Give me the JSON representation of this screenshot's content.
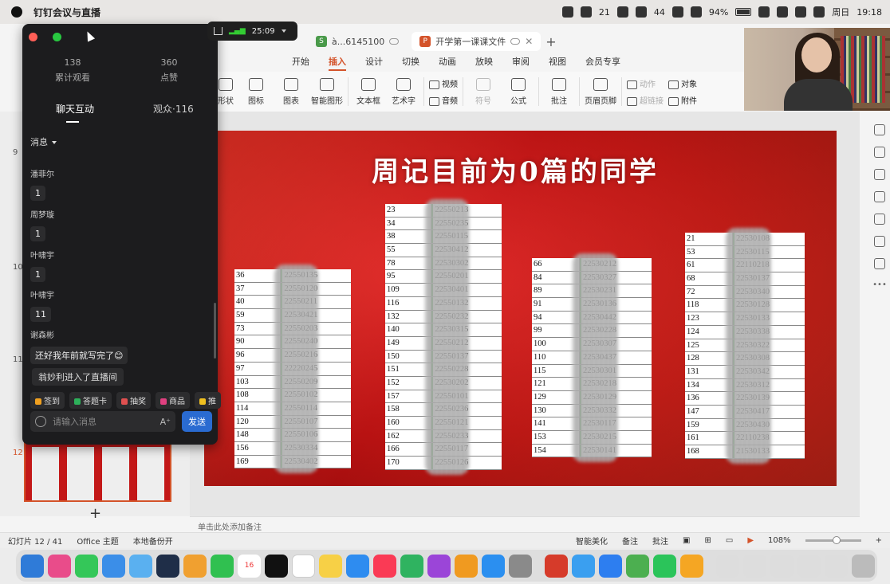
{
  "menubar": {
    "app_name": "钉钉会议与直播",
    "tray": {
      "wechat_count": "21",
      "net_count": "44",
      "battery": "94%",
      "day": "周日",
      "time": "19:18"
    }
  },
  "live": {
    "stats": [
      {
        "value": "138",
        "label": "累计观看"
      },
      {
        "value": "360",
        "label": "点赞"
      }
    ],
    "tab_chat": "聊天互动",
    "tab_viewers": "观众·116",
    "filter": "消息",
    "messages": [
      {
        "sender": "潘菲尔",
        "text": "1"
      },
      {
        "sender": "周梦璇",
        "text": "1"
      },
      {
        "sender": "叶啸宇",
        "text": "1"
      },
      {
        "sender": "叶啸宇",
        "text": "11"
      },
      {
        "sender": "谢森彬",
        "text": "还好我年前就写完了😊"
      }
    ],
    "system": "翁妙利进入了直播间",
    "actions": [
      "签到",
      "答题卡",
      "抽奖",
      "商品",
      "推"
    ],
    "input_placeholder": "请输入消息",
    "send": "发送",
    "timer": "25:09"
  },
  "wps": {
    "tabs": [
      {
        "label": "à...6145100",
        "badge": "S",
        "color": "#4a9a4a"
      },
      {
        "label": "开学第一课课文件",
        "badge": "P",
        "color": "#d4532a"
      }
    ],
    "ribbon": [
      "开始",
      "插入",
      "设计",
      "切换",
      "动画",
      "放映",
      "审阅",
      "视图",
      "会员专享"
    ],
    "active_ribbon": "插入",
    "tools": [
      "形状",
      "图标",
      "图表",
      "智能图形",
      "文本框",
      "艺术字",
      "视频",
      "音频",
      "符号",
      "公式",
      "批注",
      "页眉页脚",
      "动作",
      "超链接",
      "对象",
      "附件"
    ],
    "slide_numbers": [
      "9",
      "10",
      "11",
      "12"
    ],
    "notes": "单击此处添加备注",
    "status": {
      "slide": "幻灯片 12 / 41",
      "theme": "Office 主题",
      "backup": "本地备份开",
      "beautify": "智能美化",
      "notes": "备注",
      "comments": "批注",
      "zoom": "108%"
    }
  },
  "slide": {
    "title": "周记目前为0篇的同学",
    "tables": [
      {
        "rows": [
          [
            "36",
            "22550135"
          ],
          [
            "37",
            "22550120"
          ],
          [
            "40",
            "22550211"
          ],
          [
            "59",
            "22530421"
          ],
          [
            "73",
            "22550203"
          ],
          [
            "90",
            "22550240"
          ],
          [
            "96",
            "22550216"
          ],
          [
            "97",
            "22220245"
          ],
          [
            "103",
            "22550209"
          ],
          [
            "108",
            "22550102"
          ],
          [
            "114",
            "22550114"
          ],
          [
            "120",
            "22550107"
          ],
          [
            "148",
            "22550106"
          ],
          [
            "156",
            "22530334"
          ],
          [
            "169",
            "22530402"
          ]
        ]
      },
      {
        "rows": [
          [
            "23",
            "22550213"
          ],
          [
            "34",
            "22550235"
          ],
          [
            "38",
            "22550115"
          ],
          [
            "55",
            "22530412"
          ],
          [
            "78",
            "22530302"
          ],
          [
            "95",
            "22550201"
          ],
          [
            "109",
            "22530401"
          ],
          [
            "116",
            "22550132"
          ],
          [
            "132",
            "22550232"
          ],
          [
            "140",
            "22530315"
          ],
          [
            "149",
            "22550212"
          ],
          [
            "150",
            "22550137"
          ],
          [
            "151",
            "22550228"
          ],
          [
            "152",
            "22530202"
          ],
          [
            "157",
            "22550101"
          ],
          [
            "158",
            "22550236"
          ],
          [
            "160",
            "22550121"
          ],
          [
            "162",
            "22550233"
          ],
          [
            "166",
            "22550117"
          ],
          [
            "170",
            "22550126"
          ]
        ]
      },
      {
        "rows": [
          [
            "66",
            "22530212"
          ],
          [
            "84",
            "22530327"
          ],
          [
            "89",
            "22530231"
          ],
          [
            "91",
            "22530136"
          ],
          [
            "94",
            "22530442"
          ],
          [
            "99",
            "22530228"
          ],
          [
            "100",
            "22530307"
          ],
          [
            "110",
            "22530437"
          ],
          [
            "115",
            "22530301"
          ],
          [
            "121",
            "22530218"
          ],
          [
            "129",
            "22530129"
          ],
          [
            "130",
            "22530332"
          ],
          [
            "141",
            "22530117"
          ],
          [
            "153",
            "22530215"
          ],
          [
            "154",
            "22530141"
          ]
        ]
      },
      {
        "rows": [
          [
            "21",
            "22530108"
          ],
          [
            "53",
            "22530115"
          ],
          [
            "61",
            "22110218"
          ],
          [
            "68",
            "22530137"
          ],
          [
            "72",
            "22530340"
          ],
          [
            "118",
            "22530128"
          ],
          [
            "123",
            "22530133"
          ],
          [
            "124",
            "22530338"
          ],
          [
            "125",
            "22530322"
          ],
          [
            "128",
            "22530308"
          ],
          [
            "131",
            "22530342"
          ],
          [
            "134",
            "22530312"
          ],
          [
            "136",
            "22530139"
          ],
          [
            "147",
            "22530417"
          ],
          [
            "159",
            "22530430"
          ],
          [
            "161",
            "22110238"
          ],
          [
            "168",
            "21530133"
          ]
        ]
      }
    ]
  }
}
